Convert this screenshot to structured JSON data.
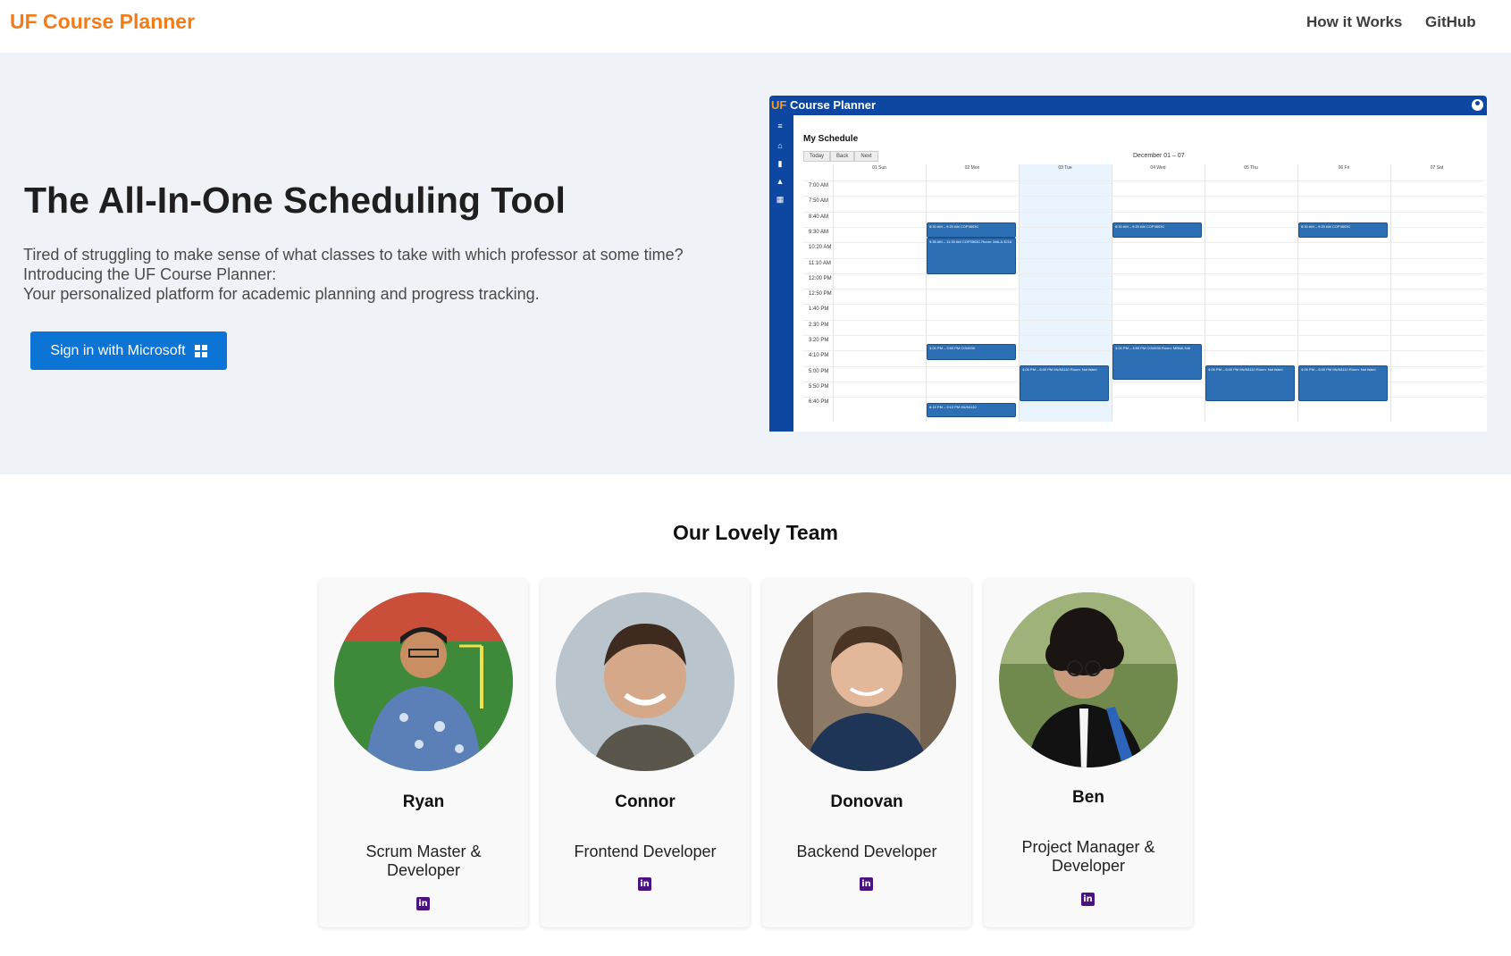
{
  "header": {
    "brand": "UF Course Planner",
    "nav": [
      "How it Works",
      "GitHub"
    ]
  },
  "hero": {
    "title": "The All-In-One Scheduling Tool",
    "description_lines": [
      "Tired of struggling to make sense of what classes to take with which professor at some time?",
      "Introducing the UF Course Planner:",
      "Your personalized platform for academic planning and progress tracking."
    ],
    "signin_label": "Sign in with Microsoft",
    "signin_icon": "windows-logo-icon",
    "brand_color": "#f07c1a",
    "button_color": "#0b74d5"
  },
  "preview": {
    "app_title_prefix": "UF",
    "app_title_rest": " Course Planner",
    "heading": "My Schedule",
    "buttons": [
      "Today",
      "Back",
      "Next"
    ],
    "range": "December 01 – 07",
    "days": [
      "01 Sun",
      "02 Mon",
      "03 Tue",
      "04 Wed",
      "05 Thu",
      "06 Fri",
      "07 Sat"
    ],
    "times": [
      "7:00 AM",
      "7:50 AM",
      "8:40 AM",
      "9:30 AM",
      "10:20 AM",
      "11:10 AM",
      "12:00 PM",
      "12:50 PM",
      "1:40 PM",
      "2:30 PM",
      "3:20 PM",
      "4:10 PM",
      "5:00 PM",
      "5:50 PM",
      "6:40 PM"
    ],
    "events": [
      {
        "label": "8:30 AM – 9:20 AM COP3503C",
        "day": 1
      },
      {
        "label": "9:35 AM – 11:30 AM COP3503C Room: MALA 3218",
        "day": 1
      },
      {
        "label": "3:00 PM – 3:50 PM CIS4930",
        "day": 1
      },
      {
        "label": "6:15 PM – 9:10 PM MUN1110",
        "day": 1
      },
      {
        "label": "4:05 PM – 6:00 PM MUN1110 Room: Not listed",
        "day": 2
      },
      {
        "label": "8:30 AM – 9:20 AM COP3503C",
        "day": 3
      },
      {
        "label": "3:00 PM – 4:55 PM CIS4930 Room: MBNA 346",
        "day": 3
      },
      {
        "label": "4:05 PM – 6:00 PM MUN1110 Room: Not listed",
        "day": 4
      },
      {
        "label": "8:30 AM – 9:20 AM COP3503C",
        "day": 5
      },
      {
        "label": "4:05 PM – 6:00 PM MUN1110 Room: Not listed",
        "day": 5
      }
    ]
  },
  "team": {
    "title": "Our Lovely Team",
    "members": [
      {
        "name": "Ryan",
        "role": "Scrum Master & Developer",
        "link_icon": "linkedin-icon"
      },
      {
        "name": "Connor",
        "role": "Frontend Developer",
        "link_icon": "linkedin-icon"
      },
      {
        "name": "Donovan",
        "role": "Backend Developer",
        "link_icon": "linkedin-icon"
      },
      {
        "name": "Ben",
        "role": "Project Manager & Developer",
        "link_icon": "linkedin-icon"
      }
    ],
    "linkedin_color": "#4b1380"
  }
}
